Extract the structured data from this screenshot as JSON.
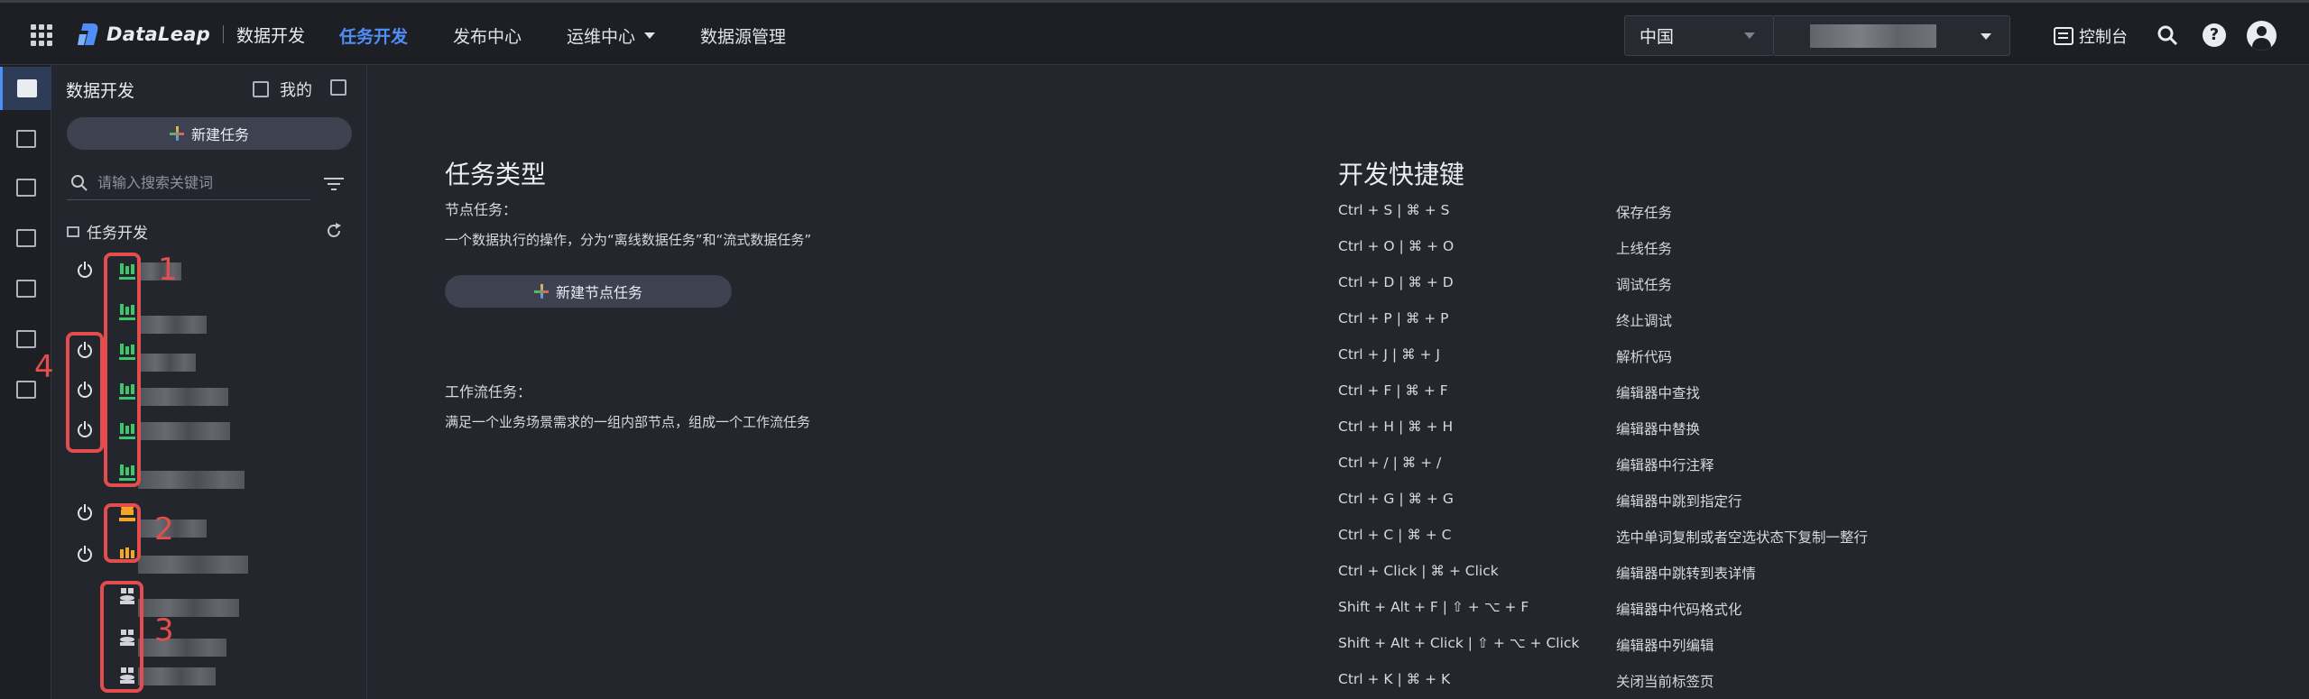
{
  "header": {
    "logo_text": "DataLeap",
    "logo_sub": "数据开发",
    "nav": [
      {
        "label": "任务开发",
        "active": true,
        "dropdown": false
      },
      {
        "label": "发布中心",
        "active": false,
        "dropdown": false
      },
      {
        "label": "运维中心",
        "active": false,
        "dropdown": true
      },
      {
        "label": "数据源管理",
        "active": false,
        "dropdown": false
      }
    ],
    "region": "中国",
    "console_label": "控制台",
    "help_label": "?"
  },
  "rail": {
    "icons": [
      "code-icon",
      "search-list-icon",
      "dashboard-icon",
      "table-icon",
      "library-icon",
      "function-icon",
      "resource-icon"
    ]
  },
  "sidebar": {
    "title": "数据开发",
    "mine_label": "我的",
    "new_task_label": "新建任务",
    "search_placeholder": "请输入搜索关键词",
    "tree_title": "任务开发",
    "annotations": [
      "1",
      "2",
      "3",
      "4"
    ]
  },
  "main": {
    "task_types": {
      "title": "任务类型",
      "node_label": "节点任务：",
      "node_desc": "一个数据执行的操作，分为“离线数据任务”和“流式数据任务”",
      "new_node_label": "新建节点任务",
      "workflow_label": "工作流任务：",
      "workflow_desc": "满足一个业务场景需求的一组内部节点，组成一个工作流任务"
    },
    "shortcuts": {
      "title": "开发快捷键",
      "rows": [
        {
          "keys": "Ctrl + S  | ⌘ + S",
          "desc": "保存任务"
        },
        {
          "keys": "Ctrl + O  | ⌘ + O",
          "desc": "上线任务"
        },
        {
          "keys": "Ctrl + D  | ⌘ + D",
          "desc": "调试任务"
        },
        {
          "keys": "Ctrl + P  | ⌘ + P",
          "desc": "终止调试"
        },
        {
          "keys": "Ctrl + J   | ⌘ + J",
          "desc": "解析代码"
        },
        {
          "keys": "Ctrl + F  | ⌘ + F",
          "desc": "编辑器中查找"
        },
        {
          "keys": "Ctrl + H  | ⌘ + H",
          "desc": "编辑器中替换"
        },
        {
          "keys": "Ctrl + /   | ⌘ + /",
          "desc": "编辑器中行注释"
        },
        {
          "keys": "Ctrl + G  | ⌘ + G",
          "desc": "编辑器中跳到指定行"
        },
        {
          "keys": "Ctrl + C  | ⌘ + C",
          "desc": "选中单词复制或者空选状态下复制一整行"
        },
        {
          "keys": "Ctrl + Click  | ⌘ + Click",
          "desc": "编辑器中跳转到表详情"
        },
        {
          "keys": "Shift + Alt + F  | ⇧ + ⌥ + F",
          "desc": "编辑器中代码格式化"
        },
        {
          "keys": "Shift + Alt + Click  | ⇧ + ⌥ + Click",
          "desc": "编辑器中列编辑"
        },
        {
          "keys": "Ctrl + K                | ⌘ + K",
          "desc": "关闭当前标签页"
        }
      ]
    }
  }
}
